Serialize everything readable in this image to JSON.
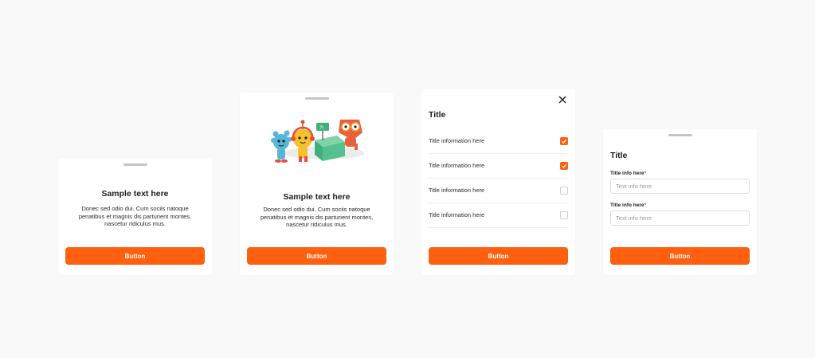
{
  "card1": {
    "heading": "Sample text here",
    "body": "Donec sed odio dui. Cum sociis natoque penatibus et magnis dis parturient montes, nascetur ridiculus mus.",
    "button_label": "Button"
  },
  "card2": {
    "illustration_icon": "mascots-illustration",
    "heading": "Sample text here",
    "body": "Donec sed odio dui. Cum sociis natoque penatibus et magnis dis parturient montes, nascetur ridiculus mus.",
    "button_label": "Button"
  },
  "card3": {
    "title": "Title",
    "items": [
      {
        "label": "Title information here",
        "checked": true
      },
      {
        "label": "Title information here",
        "checked": true
      },
      {
        "label": "Title information here",
        "checked": false
      },
      {
        "label": "Title information here",
        "checked": false
      }
    ],
    "button_label": "Button"
  },
  "card4": {
    "title": "Title",
    "fields": [
      {
        "label": "Title info here",
        "required_mark": "*",
        "placeholder": "Text info here"
      },
      {
        "label": "Title info here",
        "required_mark": "*",
        "placeholder": "Text info here"
      }
    ],
    "button_label": "Button"
  },
  "colors": {
    "accent": "#ff5f0e",
    "background": "#f9f9f9",
    "required": "#e5342b"
  }
}
